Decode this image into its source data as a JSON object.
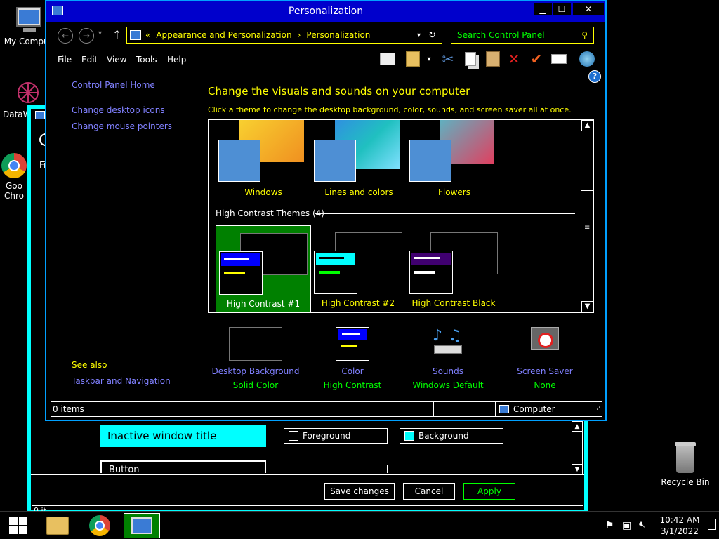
{
  "desktop": {
    "icons": [
      {
        "label": "My Computer",
        "icon": "computer-icon"
      },
      {
        "label": "DataWin",
        "icon": "datawin-icon"
      },
      {
        "label": "Google Chrome",
        "icon": "chrome-icon"
      },
      {
        "label": "Recycle Bin",
        "icon": "recycle-bin-icon"
      }
    ],
    "partial_labels": {
      "computer": "My Comput",
      "datawin": "DataW",
      "chrome1": "Goo",
      "chrome2": "Chro",
      "fi": "Fi"
    }
  },
  "back_window": {
    "inactive_title_sample": "Inactive window title",
    "foreground_label": "Foreground",
    "background_label": "Background",
    "button_sample_partial": "Button",
    "save_label": "Save changes",
    "cancel_label": "Cancel",
    "apply_label": "Apply",
    "status_items": "0 it",
    "status_computer": "Computer"
  },
  "window": {
    "title": "Personalization",
    "minimize": "▁",
    "maximize": "☐",
    "close": "✕"
  },
  "address": {
    "prefix": "«",
    "crumb1": "Appearance and Personalization",
    "sep": "›",
    "crumb2": "Personalization"
  },
  "search": {
    "placeholder": "Search Control Panel"
  },
  "menu": [
    "File",
    "Edit",
    "View",
    "Tools",
    "Help"
  ],
  "sidebar": {
    "home": "Control Panel Home",
    "links": [
      "Change desktop icons",
      "Change mouse pointers"
    ],
    "see_also_title": "See also",
    "see_also_links": [
      "Taskbar and Navigation"
    ]
  },
  "content": {
    "heading": "Change the visuals and sounds on your computer",
    "subheading": "Click a theme to change the desktop background, color, sounds, and screen saver all at once.",
    "themes": [
      "Windows",
      "Lines and colors",
      "Flowers"
    ],
    "hc_group_label": "High Contrast Themes (4)",
    "hc_themes": [
      "High Contrast #1",
      "High Contrast #2",
      "High Contrast Black"
    ],
    "selected_hc": "High Contrast #1"
  },
  "bottom": [
    {
      "label": "Desktop Background",
      "value": "Solid Color"
    },
    {
      "label": "Color",
      "value": "High Contrast"
    },
    {
      "label": "Sounds",
      "value": "Windows Default"
    },
    {
      "label": "Screen Saver",
      "value": "None"
    }
  ],
  "status": {
    "items": "0 items",
    "location": "Computer"
  },
  "taskbar": {
    "time": "10:42 AM",
    "date": "3/1/2022"
  },
  "colors": {
    "title_bar": "#0000cc",
    "link": "#8080ff",
    "highlight": "#ffff00",
    "selected": "#008000",
    "cyan": "#00ffff"
  }
}
